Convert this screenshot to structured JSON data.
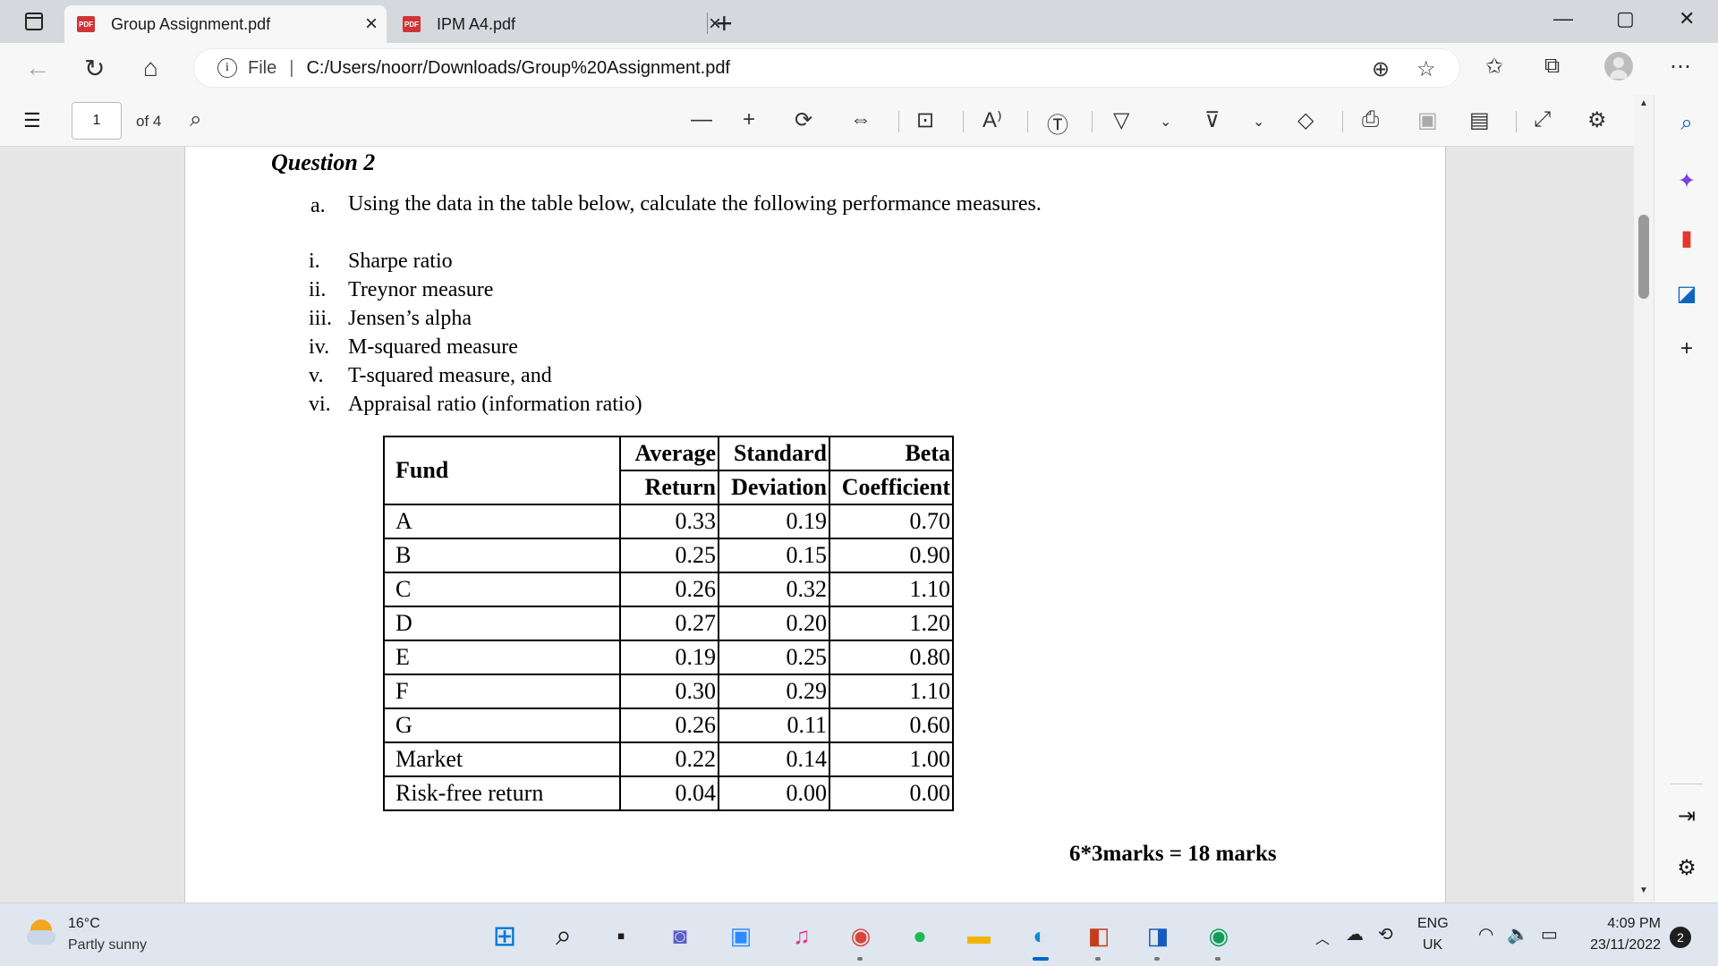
{
  "tabs": [
    {
      "title": "Group Assignment.pdf",
      "icon": "pdf-icon",
      "close": "×"
    },
    {
      "title": "IPM A4.pdf",
      "icon": "pdf-icon",
      "close": "×"
    }
  ],
  "pdf_badge": "PDF",
  "new_tab": "+",
  "window_controls": {
    "minimize": "—",
    "maximize": "▢",
    "close": "✕"
  },
  "address": {
    "scheme_label": "File",
    "url": "C:/Users/noorr/Downloads/Group%20Assignment.pdf"
  },
  "pdf_toolbar": {
    "current_page": "1",
    "page_count_label": "of 4"
  },
  "document": {
    "question_title": "Question 2",
    "part_a_label": "a.",
    "part_a_text": "Using the data in the table below, calculate the following performance measures.",
    "measures": [
      {
        "num": "i.",
        "text": "Sharpe ratio"
      },
      {
        "num": "ii.",
        "text": "Treynor measure"
      },
      {
        "num": "iii.",
        "text": "Jensen’s alpha"
      },
      {
        "num": "iv.",
        "text": "M-squared measure"
      },
      {
        "num": "v.",
        "text": "T-squared measure, and"
      },
      {
        "num": "vi.",
        "text": "Appraisal ratio (information ratio)"
      }
    ],
    "table": {
      "header_fund": "Fund",
      "header_row1": [
        "Average",
        "Standard",
        "Beta"
      ],
      "header_row2": [
        "Return",
        "Deviation",
        "Coefficient"
      ],
      "rows": [
        {
          "fund": "A",
          "ret": "0.33",
          "sd": "0.19",
          "beta": "0.70"
        },
        {
          "fund": "B",
          "ret": "0.25",
          "sd": "0.15",
          "beta": "0.90"
        },
        {
          "fund": "C",
          "ret": "0.26",
          "sd": "0.32",
          "beta": "1.10"
        },
        {
          "fund": "D",
          "ret": "0.27",
          "sd": "0.20",
          "beta": "1.20"
        },
        {
          "fund": "E",
          "ret": "0.19",
          "sd": "0.25",
          "beta": "0.80"
        },
        {
          "fund": "F",
          "ret": "0.30",
          "sd": "0.29",
          "beta": "1.10"
        },
        {
          "fund": "G",
          "ret": "0.26",
          "sd": "0.11",
          "beta": "0.60"
        },
        {
          "fund": "Market",
          "ret": "0.22",
          "sd": "0.14",
          "beta": "1.00"
        },
        {
          "fund": "Risk-free return",
          "ret": "0.04",
          "sd": "0.00",
          "beta": "0.00"
        }
      ]
    },
    "marks": "6*3marks = 18 marks"
  },
  "taskbar": {
    "weather_temp": "16°C",
    "weather_desc": "Partly sunny",
    "lang_top": "ENG",
    "lang_bottom": "UK",
    "time": "4:09 PM",
    "date": "23/11/2022",
    "notifications": "2"
  }
}
